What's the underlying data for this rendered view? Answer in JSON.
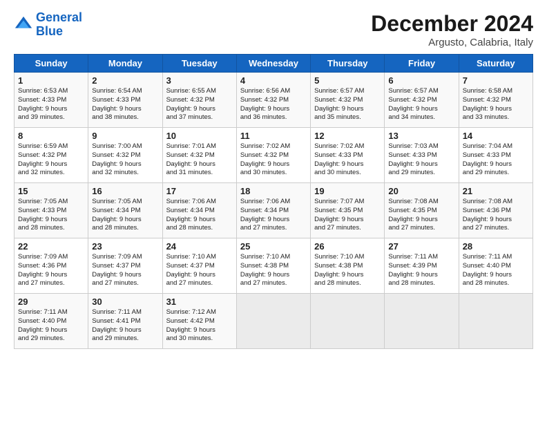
{
  "header": {
    "logo_line1": "General",
    "logo_line2": "Blue",
    "title": "December 2024",
    "subtitle": "Argusto, Calabria, Italy"
  },
  "days_of_week": [
    "Sunday",
    "Monday",
    "Tuesday",
    "Wednesday",
    "Thursday",
    "Friday",
    "Saturday"
  ],
  "weeks": [
    [
      {
        "day": "1",
        "info": "Sunrise: 6:53 AM\nSunset: 4:33 PM\nDaylight: 9 hours\nand 39 minutes."
      },
      {
        "day": "2",
        "info": "Sunrise: 6:54 AM\nSunset: 4:33 PM\nDaylight: 9 hours\nand 38 minutes."
      },
      {
        "day": "3",
        "info": "Sunrise: 6:55 AM\nSunset: 4:32 PM\nDaylight: 9 hours\nand 37 minutes."
      },
      {
        "day": "4",
        "info": "Sunrise: 6:56 AM\nSunset: 4:32 PM\nDaylight: 9 hours\nand 36 minutes."
      },
      {
        "day": "5",
        "info": "Sunrise: 6:57 AM\nSunset: 4:32 PM\nDaylight: 9 hours\nand 35 minutes."
      },
      {
        "day": "6",
        "info": "Sunrise: 6:57 AM\nSunset: 4:32 PM\nDaylight: 9 hours\nand 34 minutes."
      },
      {
        "day": "7",
        "info": "Sunrise: 6:58 AM\nSunset: 4:32 PM\nDaylight: 9 hours\nand 33 minutes."
      }
    ],
    [
      {
        "day": "8",
        "info": "Sunrise: 6:59 AM\nSunset: 4:32 PM\nDaylight: 9 hours\nand 32 minutes."
      },
      {
        "day": "9",
        "info": "Sunrise: 7:00 AM\nSunset: 4:32 PM\nDaylight: 9 hours\nand 32 minutes."
      },
      {
        "day": "10",
        "info": "Sunrise: 7:01 AM\nSunset: 4:32 PM\nDaylight: 9 hours\nand 31 minutes."
      },
      {
        "day": "11",
        "info": "Sunrise: 7:02 AM\nSunset: 4:32 PM\nDaylight: 9 hours\nand 30 minutes."
      },
      {
        "day": "12",
        "info": "Sunrise: 7:02 AM\nSunset: 4:33 PM\nDaylight: 9 hours\nand 30 minutes."
      },
      {
        "day": "13",
        "info": "Sunrise: 7:03 AM\nSunset: 4:33 PM\nDaylight: 9 hours\nand 29 minutes."
      },
      {
        "day": "14",
        "info": "Sunrise: 7:04 AM\nSunset: 4:33 PM\nDaylight: 9 hours\nand 29 minutes."
      }
    ],
    [
      {
        "day": "15",
        "info": "Sunrise: 7:05 AM\nSunset: 4:33 PM\nDaylight: 9 hours\nand 28 minutes."
      },
      {
        "day": "16",
        "info": "Sunrise: 7:05 AM\nSunset: 4:34 PM\nDaylight: 9 hours\nand 28 minutes."
      },
      {
        "day": "17",
        "info": "Sunrise: 7:06 AM\nSunset: 4:34 PM\nDaylight: 9 hours\nand 28 minutes."
      },
      {
        "day": "18",
        "info": "Sunrise: 7:06 AM\nSunset: 4:34 PM\nDaylight: 9 hours\nand 27 minutes."
      },
      {
        "day": "19",
        "info": "Sunrise: 7:07 AM\nSunset: 4:35 PM\nDaylight: 9 hours\nand 27 minutes."
      },
      {
        "day": "20",
        "info": "Sunrise: 7:08 AM\nSunset: 4:35 PM\nDaylight: 9 hours\nand 27 minutes."
      },
      {
        "day": "21",
        "info": "Sunrise: 7:08 AM\nSunset: 4:36 PM\nDaylight: 9 hours\nand 27 minutes."
      }
    ],
    [
      {
        "day": "22",
        "info": "Sunrise: 7:09 AM\nSunset: 4:36 PM\nDaylight: 9 hours\nand 27 minutes."
      },
      {
        "day": "23",
        "info": "Sunrise: 7:09 AM\nSunset: 4:37 PM\nDaylight: 9 hours\nand 27 minutes."
      },
      {
        "day": "24",
        "info": "Sunrise: 7:10 AM\nSunset: 4:37 PM\nDaylight: 9 hours\nand 27 minutes."
      },
      {
        "day": "25",
        "info": "Sunrise: 7:10 AM\nSunset: 4:38 PM\nDaylight: 9 hours\nand 27 minutes."
      },
      {
        "day": "26",
        "info": "Sunrise: 7:10 AM\nSunset: 4:38 PM\nDaylight: 9 hours\nand 28 minutes."
      },
      {
        "day": "27",
        "info": "Sunrise: 7:11 AM\nSunset: 4:39 PM\nDaylight: 9 hours\nand 28 minutes."
      },
      {
        "day": "28",
        "info": "Sunrise: 7:11 AM\nSunset: 4:40 PM\nDaylight: 9 hours\nand 28 minutes."
      }
    ],
    [
      {
        "day": "29",
        "info": "Sunrise: 7:11 AM\nSunset: 4:40 PM\nDaylight: 9 hours\nand 29 minutes."
      },
      {
        "day": "30",
        "info": "Sunrise: 7:11 AM\nSunset: 4:41 PM\nDaylight: 9 hours\nand 29 minutes."
      },
      {
        "day": "31",
        "info": "Sunrise: 7:12 AM\nSunset: 4:42 PM\nDaylight: 9 hours\nand 30 minutes."
      },
      {
        "day": "",
        "info": ""
      },
      {
        "day": "",
        "info": ""
      },
      {
        "day": "",
        "info": ""
      },
      {
        "day": "",
        "info": ""
      }
    ]
  ]
}
